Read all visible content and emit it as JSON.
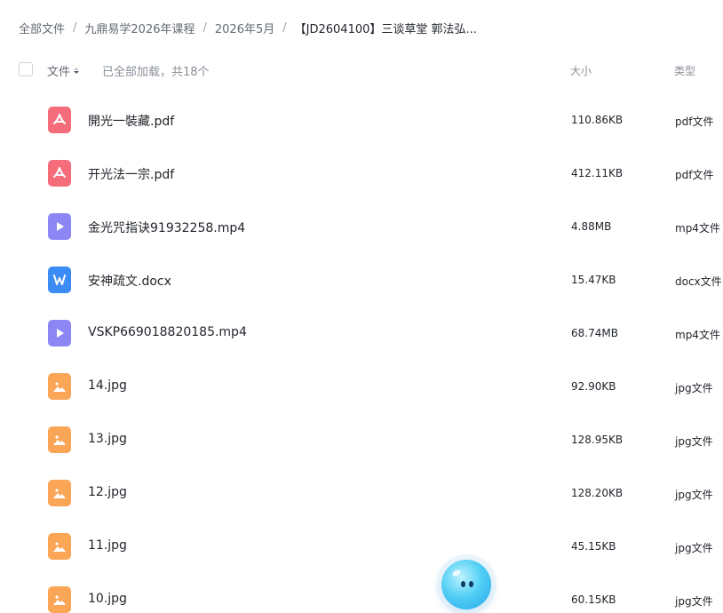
{
  "breadcrumb": {
    "items": [
      "全部文件",
      "九鼎易学2026年课程",
      "2026年5月",
      "【JD2604100】三谈草堂 郭法弘..."
    ],
    "separator": "/"
  },
  "header": {
    "name_label": "文件",
    "loaded_text": "已全部加载，共18个",
    "size_label": "大小",
    "type_label": "类型"
  },
  "files": [
    {
      "name": "開光一裝藏.pdf",
      "size": "110.86KB",
      "type": "pdf文件",
      "icon": "pdf-icon"
    },
    {
      "name": "开光法一宗.pdf",
      "size": "412.11KB",
      "type": "pdf文件",
      "icon": "pdf-icon"
    },
    {
      "name": "金光咒指诀91932258.mp4",
      "size": "4.88MB",
      "type": "mp4文件",
      "icon": "video-icon"
    },
    {
      "name": "安神疏文.docx",
      "size": "15.47KB",
      "type": "docx文件",
      "icon": "word-icon"
    },
    {
      "name": "VSKP669018820185.mp4",
      "size": "68.74MB",
      "type": "mp4文件",
      "icon": "video-icon"
    },
    {
      "name": "14.jpg",
      "size": "92.90KB",
      "type": "jpg文件",
      "icon": "image-icon"
    },
    {
      "name": "13.jpg",
      "size": "128.95KB",
      "type": "jpg文件",
      "icon": "image-icon"
    },
    {
      "name": "12.jpg",
      "size": "128.20KB",
      "type": "jpg文件",
      "icon": "image-icon"
    },
    {
      "name": "11.jpg",
      "size": "45.15KB",
      "type": "jpg文件",
      "icon": "image-icon"
    },
    {
      "name": "10.jpg",
      "size": "60.15KB",
      "type": "jpg文件",
      "icon": "image-icon"
    }
  ],
  "colors": {
    "pdf": "#f56c7b",
    "video": "#8c86f5",
    "word": "#3b8cf5",
    "image": "#fba557"
  }
}
